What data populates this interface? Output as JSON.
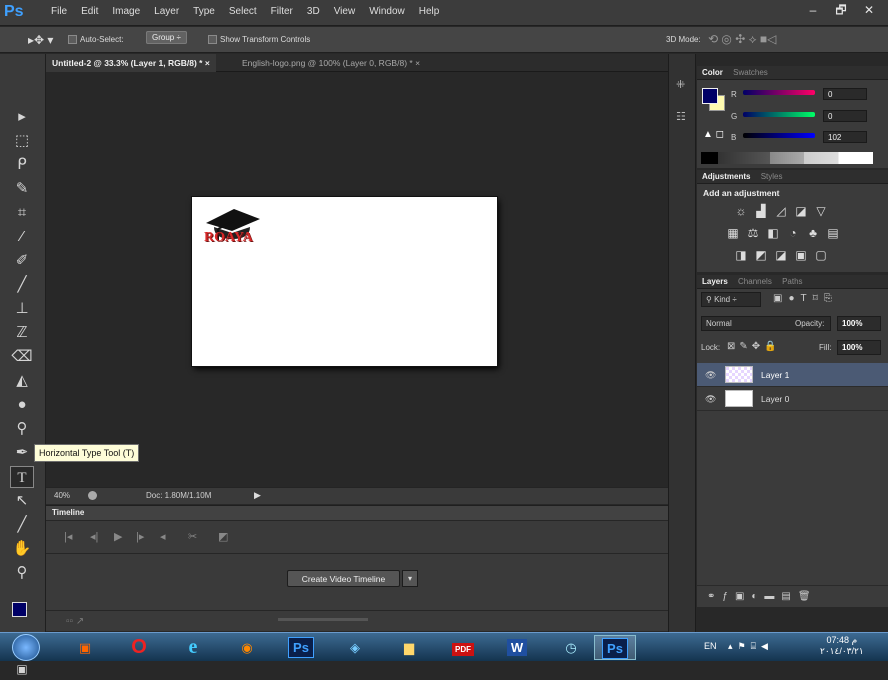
{
  "app": {
    "logo": "Ps"
  },
  "menu": [
    "File",
    "Edit",
    "Image",
    "Layer",
    "Type",
    "Select",
    "Filter",
    "3D",
    "View",
    "Window",
    "Help"
  ],
  "window_controls": {
    "minimize": "–",
    "restore": "🗗",
    "close": "✕"
  },
  "options": {
    "auto_select": "Auto-Select:",
    "group": "Group",
    "show_transform": "Show Transform Controls",
    "mode_3d": "3D Mode:"
  },
  "tabs": [
    {
      "title": "Untitled-2 @ 33.3% (Layer 1, RGB/8) *",
      "close": "×"
    },
    {
      "title": "English-logo.png @ 100% (Layer 0, RGB/8) *",
      "close": "×"
    }
  ],
  "document": {
    "logo_text": "ROAYA"
  },
  "tooltip": "Horizontal Type Tool (T)",
  "status": {
    "zoom": "40%",
    "doc": "Doc: 1.80M/1.10M"
  },
  "timeline": {
    "title": "Timeline",
    "create_button": "Create Video Timeline"
  },
  "color_panel": {
    "tabs": [
      "Color",
      "Swatches"
    ],
    "channels": [
      {
        "label": "R",
        "value": "0"
      },
      {
        "label": "G",
        "value": "0"
      },
      {
        "label": "B",
        "value": "102"
      }
    ],
    "colors": {
      "foreground": "#000066",
      "background": "#fffbb0"
    }
  },
  "adjustments": {
    "tabs": [
      "Adjustments",
      "Styles"
    ],
    "heading": "Add an adjustment"
  },
  "layers": {
    "tabs": [
      "Layers",
      "Channels",
      "Paths"
    ],
    "kind": "Kind",
    "blend": "Normal",
    "opacity_label": "Opacity:",
    "opacity": "100%",
    "lock_label": "Lock:",
    "fill_label": "Fill:",
    "fill": "100%",
    "items": [
      {
        "name": "Layer 1",
        "selected": true
      },
      {
        "name": "Layer 0",
        "selected": false
      }
    ]
  },
  "taskbar": {
    "lang": "EN",
    "time": "07:48 م",
    "date": "٢٠١٤/٠٣/٢١",
    "ps_label": "Ps",
    "pdf_label": "PDF",
    "word_label": "W"
  }
}
